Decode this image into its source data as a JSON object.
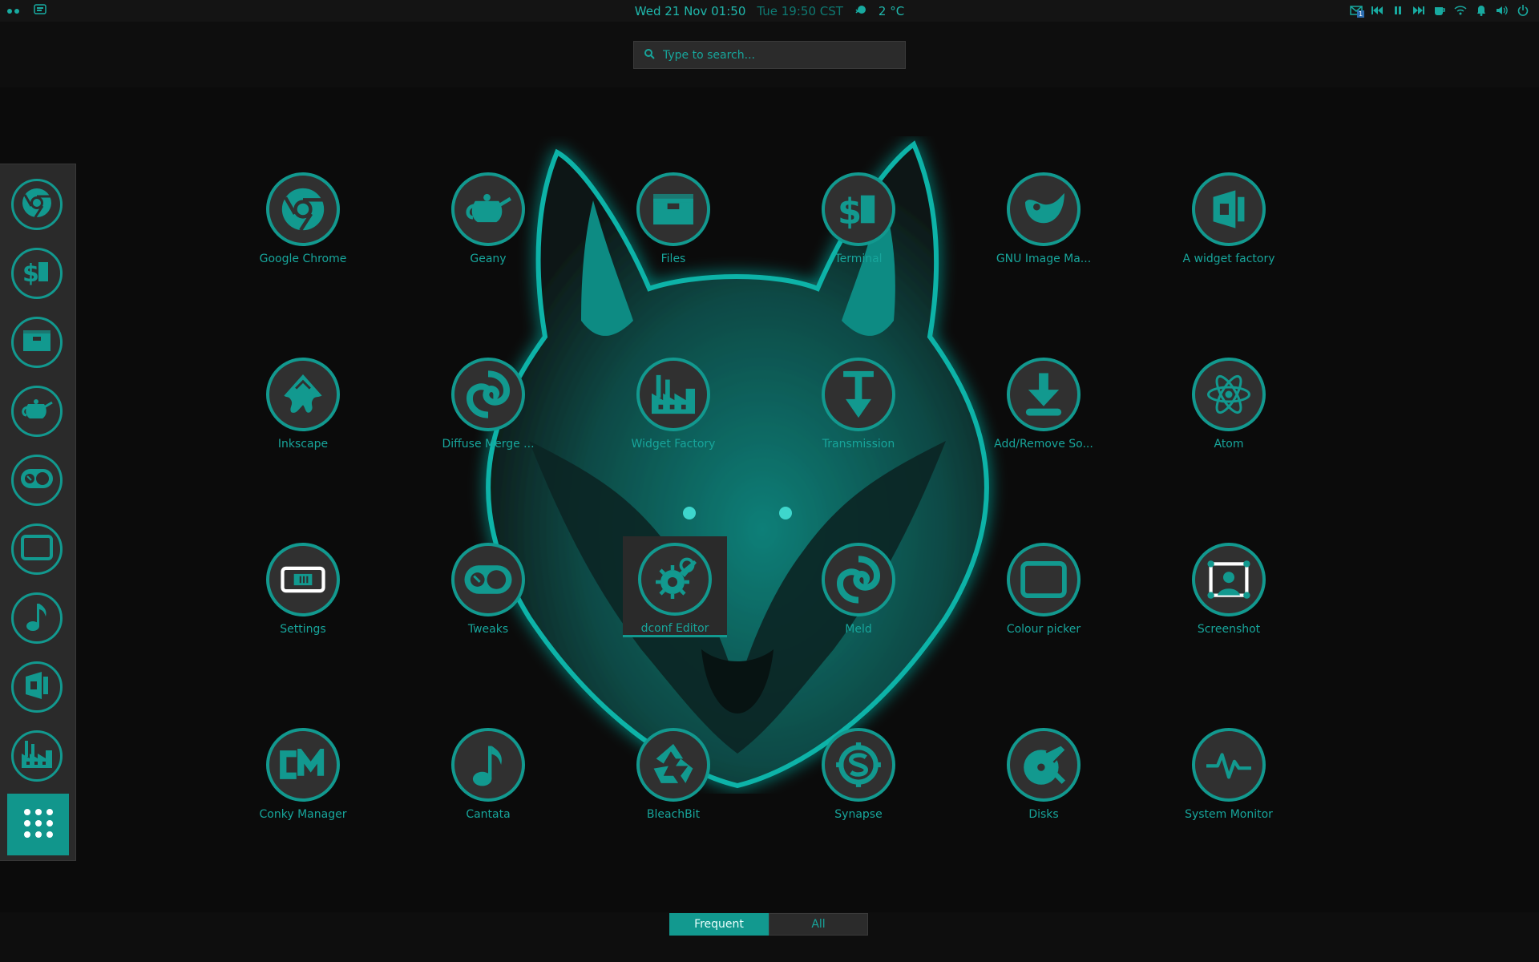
{
  "topbar": {
    "clock": "Wed 21 Nov  01:50",
    "world_clock": "Tue 19:50 CST",
    "weather": "2 °C",
    "mail_count": "1"
  },
  "search": {
    "placeholder": "Type to search..."
  },
  "apps": [
    {
      "label": "Google Chrome",
      "icon": "chrome-icon"
    },
    {
      "label": "Geany",
      "icon": "teapot-icon"
    },
    {
      "label": "Files",
      "icon": "files-icon"
    },
    {
      "label": "Terminal",
      "icon": "terminal-icon"
    },
    {
      "label": "GNU Image Ma...",
      "icon": "gimp-icon"
    },
    {
      "label": "A widget factory",
      "icon": "widget-factory-icon"
    },
    {
      "label": "Inkscape",
      "icon": "inkscape-icon"
    },
    {
      "label": "Diffuse Merge ...",
      "icon": "diffuse-icon"
    },
    {
      "label": "Widget Factory",
      "icon": "factory-icon"
    },
    {
      "label": "Transmission",
      "icon": "transmission-icon"
    },
    {
      "label": "Add/Remove So...",
      "icon": "software-install-icon"
    },
    {
      "label": "Atom",
      "icon": "atom-icon"
    },
    {
      "label": "Settings",
      "icon": "settings-icon"
    },
    {
      "label": "Tweaks",
      "icon": "tweaks-icon"
    },
    {
      "label": "dconf Editor",
      "icon": "dconf-icon"
    },
    {
      "label": "Meld",
      "icon": "meld-icon"
    },
    {
      "label": "Colour picker",
      "icon": "colour-picker-icon"
    },
    {
      "label": "Screenshot",
      "icon": "screenshot-icon"
    },
    {
      "label": "Conky Manager",
      "icon": "conky-icon"
    },
    {
      "label": "Cantata",
      "icon": "music-note-icon"
    },
    {
      "label": "BleachBit",
      "icon": "recycle-icon"
    },
    {
      "label": "Synapse",
      "icon": "synapse-icon"
    },
    {
      "label": "Disks",
      "icon": "disks-icon"
    },
    {
      "label": "System Monitor",
      "icon": "system-monitor-icon"
    }
  ],
  "selected_app": "dconf Editor",
  "tabs": {
    "frequent": "Frequent",
    "all": "All"
  },
  "colors": {
    "accent": "#12998f",
    "text": "#17a59b",
    "background": "#0b0b0b"
  }
}
